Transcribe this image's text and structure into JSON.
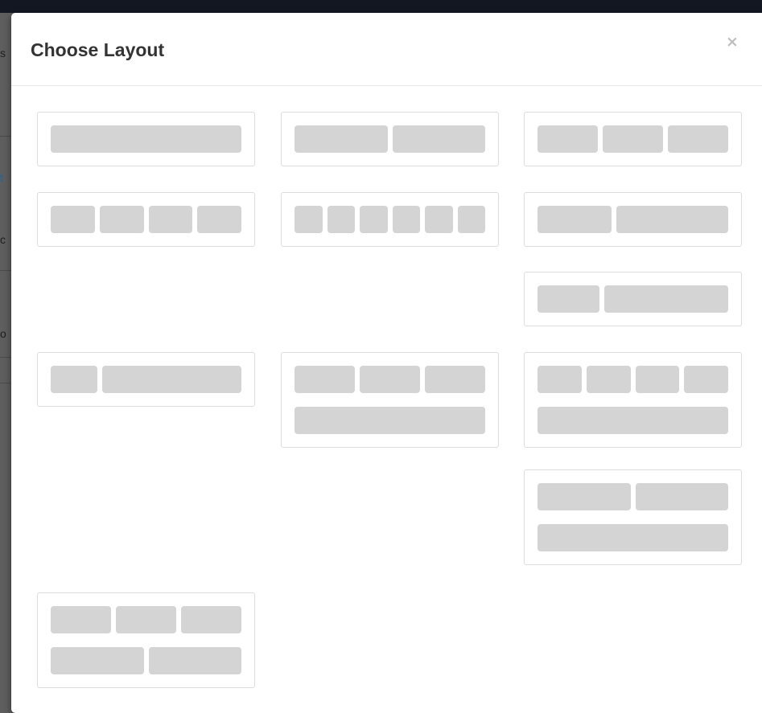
{
  "backdrop_fragments": [
    "s",
    "t",
    "c",
    "o"
  ],
  "modal": {
    "title": "Choose Layout",
    "close_label": "×",
    "close_icon": "close-icon"
  },
  "layouts": [
    {
      "name": "layout-1-col",
      "rows": [
        [
          1
        ]
      ]
    },
    {
      "name": "layout-2-col",
      "rows": [
        [
          1,
          1
        ]
      ]
    },
    {
      "name": "layout-3-col",
      "rows": [
        [
          1,
          1,
          1
        ]
      ]
    },
    {
      "name": "layout-4-col",
      "rows": [
        [
          1,
          1,
          1,
          1
        ]
      ]
    },
    {
      "name": "layout-6-col",
      "rows": [
        [
          1,
          1,
          1,
          1,
          1,
          1
        ]
      ]
    },
    {
      "name": "layout-40-60",
      "rows": [
        [
          4,
          6
        ]
      ]
    },
    {
      "name": "layout-33-67",
      "rows": [
        [
          1,
          2
        ]
      ]
    },
    {
      "name": "layout-25-75",
      "rows": [
        [
          1,
          3
        ]
      ]
    },
    {
      "name": "layout-3-over-1",
      "rows": [
        [
          1,
          1,
          1
        ],
        [
          1
        ]
      ]
    },
    {
      "name": "layout-4-over-1",
      "rows": [
        [
          1,
          1,
          1,
          1
        ],
        [
          1
        ]
      ]
    },
    {
      "name": "layout-2-over-1",
      "rows": [
        [
          1,
          1
        ],
        [
          1
        ]
      ]
    },
    {
      "name": "layout-3-over-2",
      "rows": [
        [
          1,
          1,
          1
        ],
        [
          1,
          1
        ]
      ]
    }
  ],
  "colors": {
    "backdrop": "#5e5e5e",
    "topbar": "#131722",
    "card_border": "#dcdcdc",
    "block": "#d4d4d4",
    "title": "#333333",
    "close": "#bdbdbd"
  }
}
